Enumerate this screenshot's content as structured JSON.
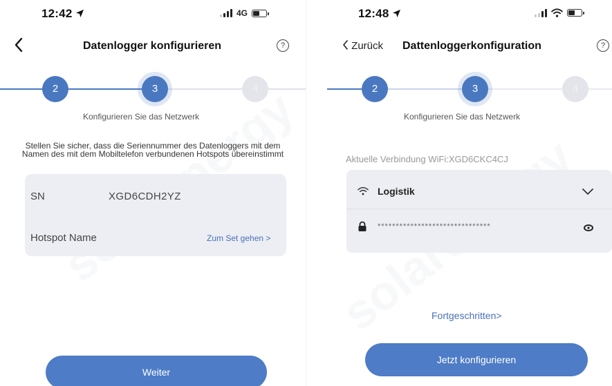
{
  "left": {
    "status": {
      "time": "12:42",
      "network": "4G"
    },
    "nav": {
      "title": "Datenlogger konfigurieren",
      "help": "?"
    },
    "steps": {
      "prev": "2",
      "current": "3",
      "next": "4"
    },
    "step_label": "Konfigurieren Sie das Netzwerk",
    "instruction": "Stellen Sie sicher, dass die Seriennummer des Datenloggers mit dem Namen des mit dem Mobiltelefon verbundenen Hotspots übereinstimmt",
    "sn_label": "SN",
    "sn_value": "XGD6CDH2YZ",
    "hotspot_label": "Hotspot Name",
    "hotspot_link": "Zum Set gehen >",
    "button": "Weiter"
  },
  "right": {
    "status": {
      "time": "12:48"
    },
    "nav": {
      "back": "Zurück",
      "title": "Dattenloggerkonfiguration",
      "help": "?"
    },
    "steps": {
      "prev": "2",
      "current": "3",
      "next": "4"
    },
    "step_label": "Konfigurieren Sie das Netzwerk",
    "current_connection": "Aktuelle Verbindung WiFi:XGD6CKC4CJ",
    "wifi_name": "Logistik",
    "password_mask": "*******************************",
    "advanced": "Fortgeschritten>",
    "button": "Jetzt konfigurieren"
  },
  "watermark": "solarenergy"
}
